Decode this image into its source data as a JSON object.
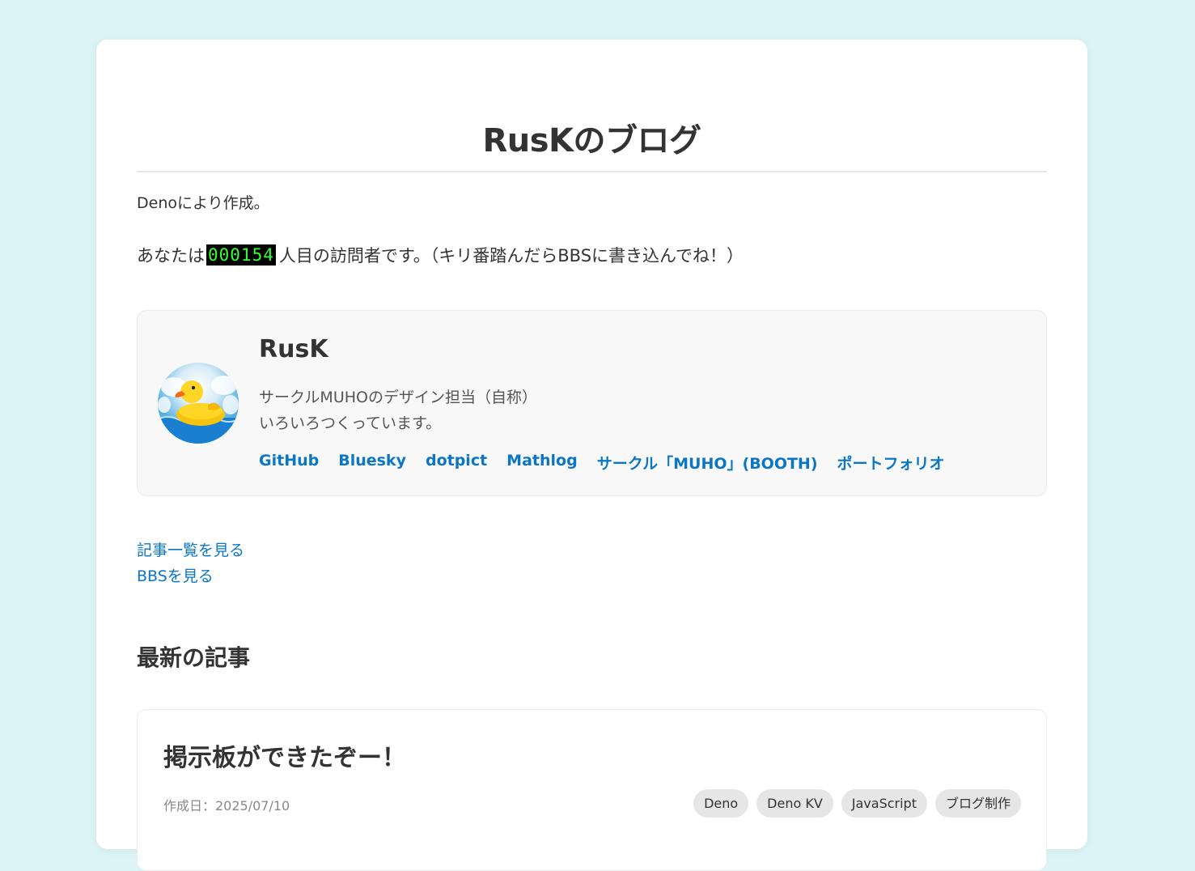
{
  "site": {
    "title": "RusKのブログ",
    "description": "Denoにより作成。"
  },
  "visitor": {
    "prefix": "あなたは",
    "count": "000154",
    "suffix": "人目の訪問者です。（キリ番踏んだらBBSに書き込んでね！）"
  },
  "profile": {
    "name": "RusK",
    "bio_line1": "サークルMUHOのデザイン担当（自称）",
    "bio_line2": "いろいろつくっています。",
    "links": [
      {
        "label": "GitHub"
      },
      {
        "label": "Bluesky"
      },
      {
        "label": "dotpict"
      },
      {
        "label": "Mathlog"
      },
      {
        "label": "サークル「MUHO」(BOOTH)"
      },
      {
        "label": "ポートフォリオ"
      }
    ]
  },
  "nav": {
    "articles_label": "記事一覧を見る",
    "bbs_label": "BBSを見る"
  },
  "latest": {
    "heading": "最新の記事",
    "post": {
      "title": "掲示板ができたぞー！",
      "date": "作成日：2025/07/10",
      "tags": [
        "Deno",
        "Deno KV",
        "JavaScript",
        "ブログ制作"
      ]
    }
  },
  "colors": {
    "background": "#dcf4f5",
    "link": "#0a76c4",
    "counter_digits": "#35ff35"
  }
}
